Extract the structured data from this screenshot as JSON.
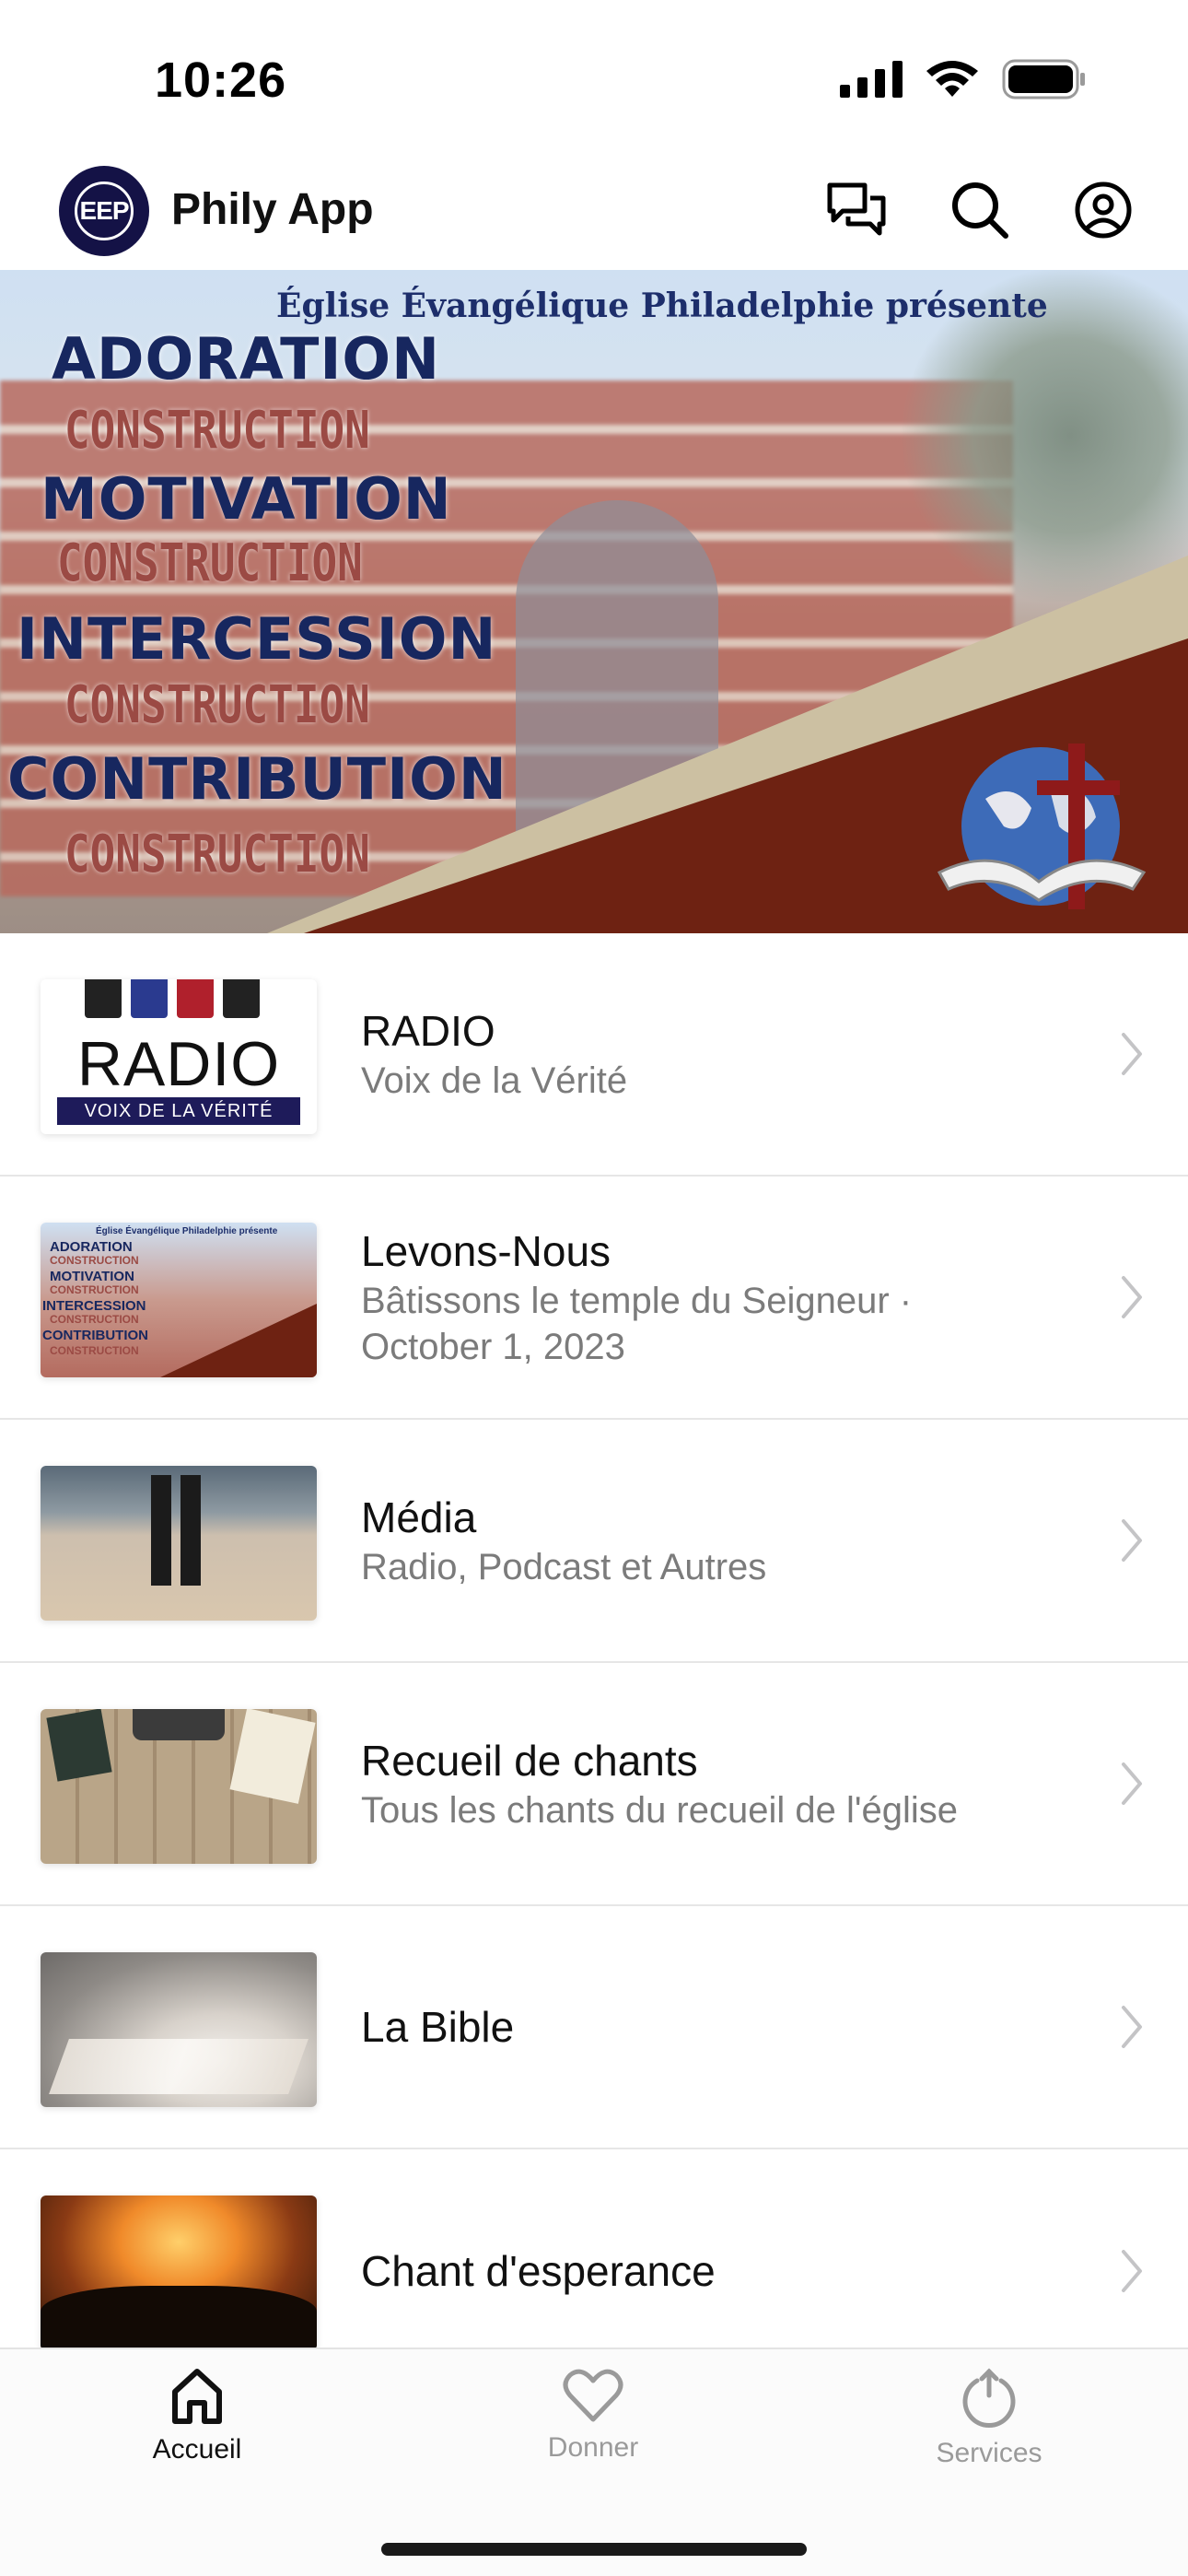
{
  "status_bar": {
    "time": "10:26"
  },
  "header": {
    "logo_text": "EEP",
    "title": "Phily App",
    "actions": [
      {
        "icon": "chat-icon"
      },
      {
        "icon": "search-icon"
      },
      {
        "icon": "profile-icon"
      }
    ]
  },
  "banner": {
    "presents": "Église Évangélique Philadelphie présente",
    "words": [
      "ADORATION",
      "CONSTRUCTION",
      "MOTIVATION",
      "CONSTRUCTION",
      "INTERCESSION",
      "CONSTRUCTION",
      "CONTRIBUTION",
      "CONSTRUCTION"
    ]
  },
  "list": {
    "items": [
      {
        "title": "RADIO",
        "subtitle": "Voix de la Vérité",
        "thumb_word": "RADIO",
        "thumb_tag": "VOIX DE LA VÉRITÉ"
      },
      {
        "title": "Levons-Nous",
        "subtitle": "Bâtissons le temple du Seigneur · October 1, 2023",
        "thumb_presents": "Église Évangélique Philadelphie présente",
        "thumb_words": [
          "ADORATION",
          "CONSTRUCTION",
          "MOTIVATION",
          "CONSTRUCTION",
          "INTERCESSION",
          "CONSTRUCTION",
          "CONTRIBUTION",
          "CONSTRUCTION"
        ]
      },
      {
        "title": "Média",
        "subtitle": "Radio, Podcast et Autres"
      },
      {
        "title": "Recueil de chants",
        "subtitle": "Tous les chants du recueil de l'église"
      },
      {
        "title": "La Bible",
        "subtitle": ""
      },
      {
        "title": "Chant d'esperance",
        "subtitle": ""
      }
    ]
  },
  "tabs": [
    {
      "label": "Accueil",
      "icon": "home-icon",
      "active": true
    },
    {
      "label": "Donner",
      "icon": "heart-icon",
      "active": false
    },
    {
      "label": "Services",
      "icon": "power-icon",
      "active": false
    }
  ],
  "colors": {
    "accent": "#141246",
    "banner_blue": "#17275f",
    "banner_red": "#9b4a44",
    "tab_inactive": "#9a9a9a"
  }
}
